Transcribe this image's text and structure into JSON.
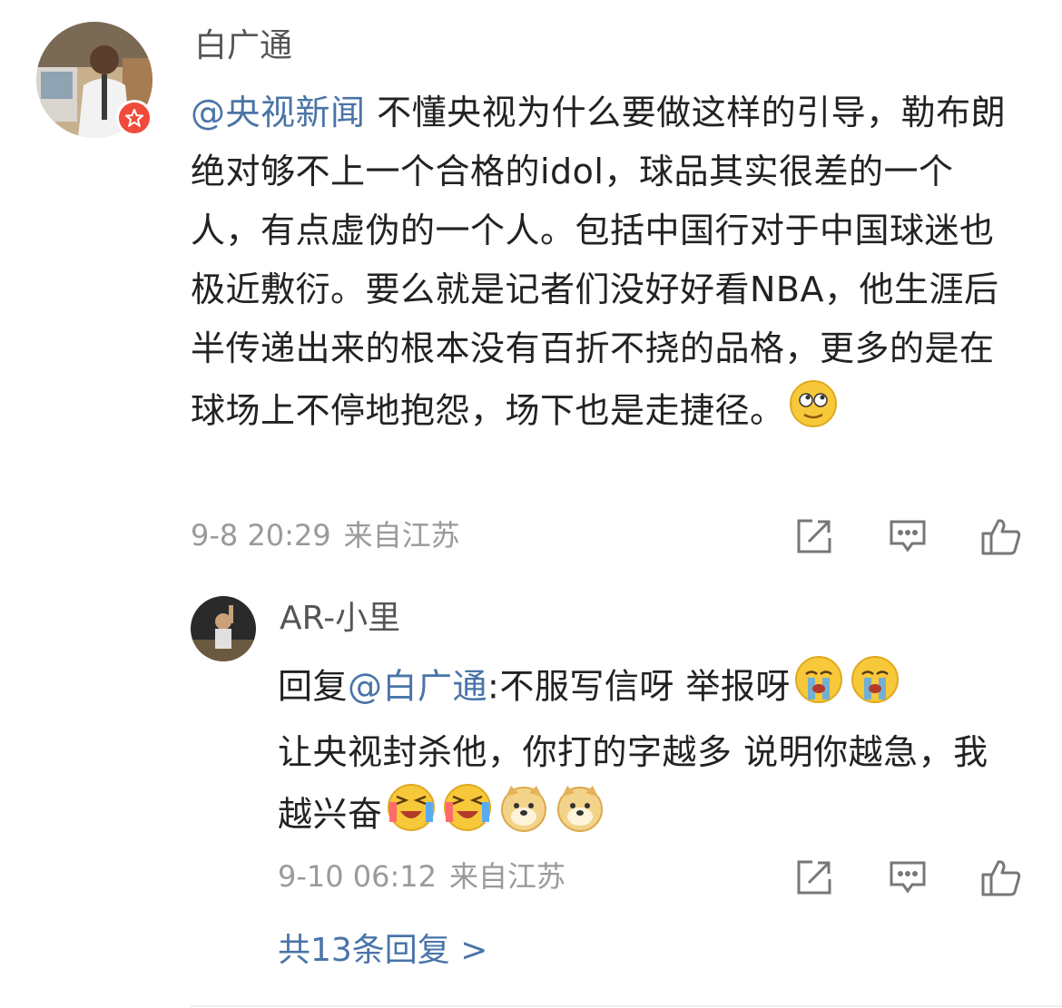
{
  "comment": {
    "username": "白广通",
    "mention": "@央视新闻",
    "text": " 不懂央视为什么要做这样的引导，勒布朗绝对够不上一个合格的idol，球品其实很差的一个人，有点虚伪的一个人。包括中国行对于中国球迷也极近敷衍。要么就是记者们没好好看NBA，他生涯后半传递出来的根本没有百折不挠的品格，更多的是在球场上不停地抱怨，场下也是走捷径。",
    "emoji": "doge-face-icon",
    "date": "9-8 20:29",
    "location": "来自江苏",
    "badge_icon": "verified-star-icon"
  },
  "reply": {
    "username": "AR-小里",
    "prefix": "回复",
    "mention": "@白广通",
    "text_1": ":不服写信呀 举报呀",
    "text_2": "让央视封杀他，你打的字越多 说明你越急，我越兴奋",
    "emojis_1": [
      "crying-face-icon",
      "crying-face-icon"
    ],
    "emojis_2": [
      "laughing-tears-icon",
      "laughing-tears-icon",
      "doge-icon",
      "doge-icon"
    ],
    "date": "9-10 06:12",
    "location": "来自江苏"
  },
  "more_replies": "共13条回复 >",
  "actions": [
    "share-icon",
    "comment-icon",
    "like-icon"
  ],
  "colors": {
    "link": "#4a74a8",
    "meta": "#9a9a9a",
    "badge": "#f04a3a",
    "emoji": "#f7c83a"
  }
}
